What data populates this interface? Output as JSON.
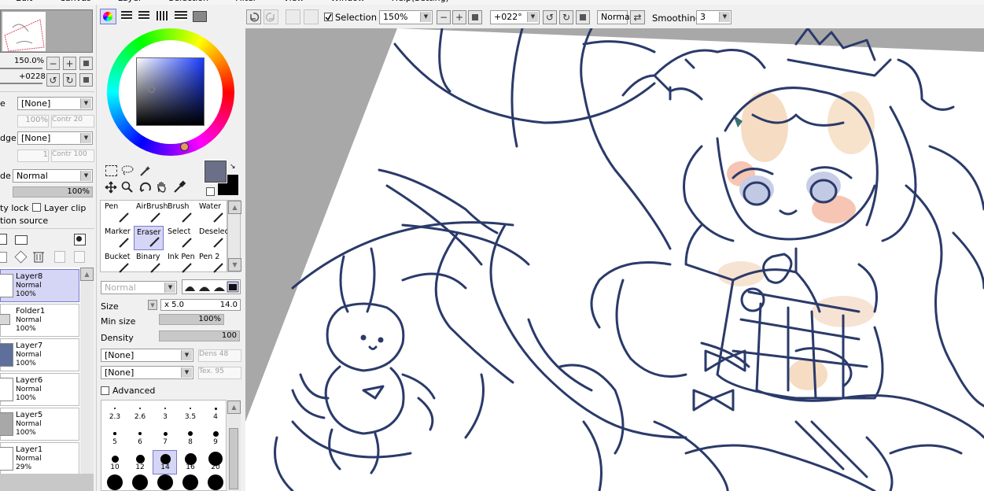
{
  "menu": [
    "Edit",
    "Canvas",
    "Layer",
    "Selection",
    "Filter",
    "View",
    "Window",
    "Help(Setting)"
  ],
  "navigator": {
    "zoom": "150.0%",
    "angle": "+0228"
  },
  "toolbar": {
    "selection_label": "Selection",
    "zoom": "150%",
    "angle": "+022°",
    "blend_mode": "Normal",
    "smoothing_label": "Smoothing",
    "smoothing_value": "3"
  },
  "layer_props": {
    "texture_label": "e",
    "texture_value": "[None]",
    "texture_pct": "100%",
    "texture_contr": "Contr 20",
    "effect_label": "dge",
    "effect_value": "[None]",
    "effect_num": "1",
    "effect_contr": "Contr 100",
    "mode_label": "de",
    "mode_value": "Normal",
    "opacity": "100%",
    "protect_label": "ty lock",
    "clip_label": "Layer clip",
    "source_label": "tion source"
  },
  "layers": [
    {
      "name": "Layer8",
      "mode": "Normal",
      "opacity": "100%",
      "selected": true
    },
    {
      "name": "Folder1",
      "mode": "Normal",
      "opacity": "100%",
      "selected": false
    },
    {
      "name": "Layer7",
      "mode": "Normal",
      "opacity": "100%",
      "selected": false
    },
    {
      "name": "Layer6",
      "mode": "Normal",
      "opacity": "100%",
      "selected": false
    },
    {
      "name": "Layer5",
      "mode": "Normal",
      "opacity": "100%",
      "selected": false
    },
    {
      "name": "Layer1",
      "mode": "Normal",
      "opacity": "29%",
      "selected": false
    }
  ],
  "colors": {
    "primary": "#6b7088",
    "secondary": "#000000",
    "line": "#2a3a6a",
    "selected_bg": "#d5d5f5",
    "selected_border": "#7a7ad0"
  },
  "tools": [
    {
      "label": "Pen",
      "icon": "pen-icon"
    },
    {
      "label": "AirBrush",
      "icon": "airbrush-icon"
    },
    {
      "label": "Brush",
      "icon": "brush-icon"
    },
    {
      "label": "Water",
      "icon": "water-icon"
    },
    {
      "label": "Marker",
      "icon": "marker-icon"
    },
    {
      "label": "Eraser",
      "icon": "eraser-icon"
    },
    {
      "label": "Select",
      "icon": "select-icon"
    },
    {
      "label": "Deselect",
      "icon": "deselect-icon"
    },
    {
      "label": "Bucket",
      "icon": "bucket-icon"
    },
    {
      "label": "Binary",
      "icon": "binary-icon"
    },
    {
      "label": "Ink Pen",
      "icon": "ink-pen-icon"
    },
    {
      "label": "Pen 2",
      "icon": "pen2-icon"
    }
  ],
  "brush": {
    "blend_value": "Normal",
    "size_label": "Size",
    "size_mult": "x 5.0",
    "size_value": "14.0",
    "minsize_label": "Min size",
    "minsize_value": "100%",
    "density_label": "Density",
    "density_value": "100",
    "shape_value": "[None]",
    "shape_dens": "Dens 48",
    "texture_value": "[None]",
    "texture_tex": "Tex. 95",
    "advanced_label": "Advanced"
  },
  "brush_sizes": [
    "2.3",
    "2.6",
    "3",
    "3.5",
    "4",
    "5",
    "6",
    "7",
    "8",
    "9",
    "10",
    "12",
    "14",
    "16",
    "20"
  ]
}
